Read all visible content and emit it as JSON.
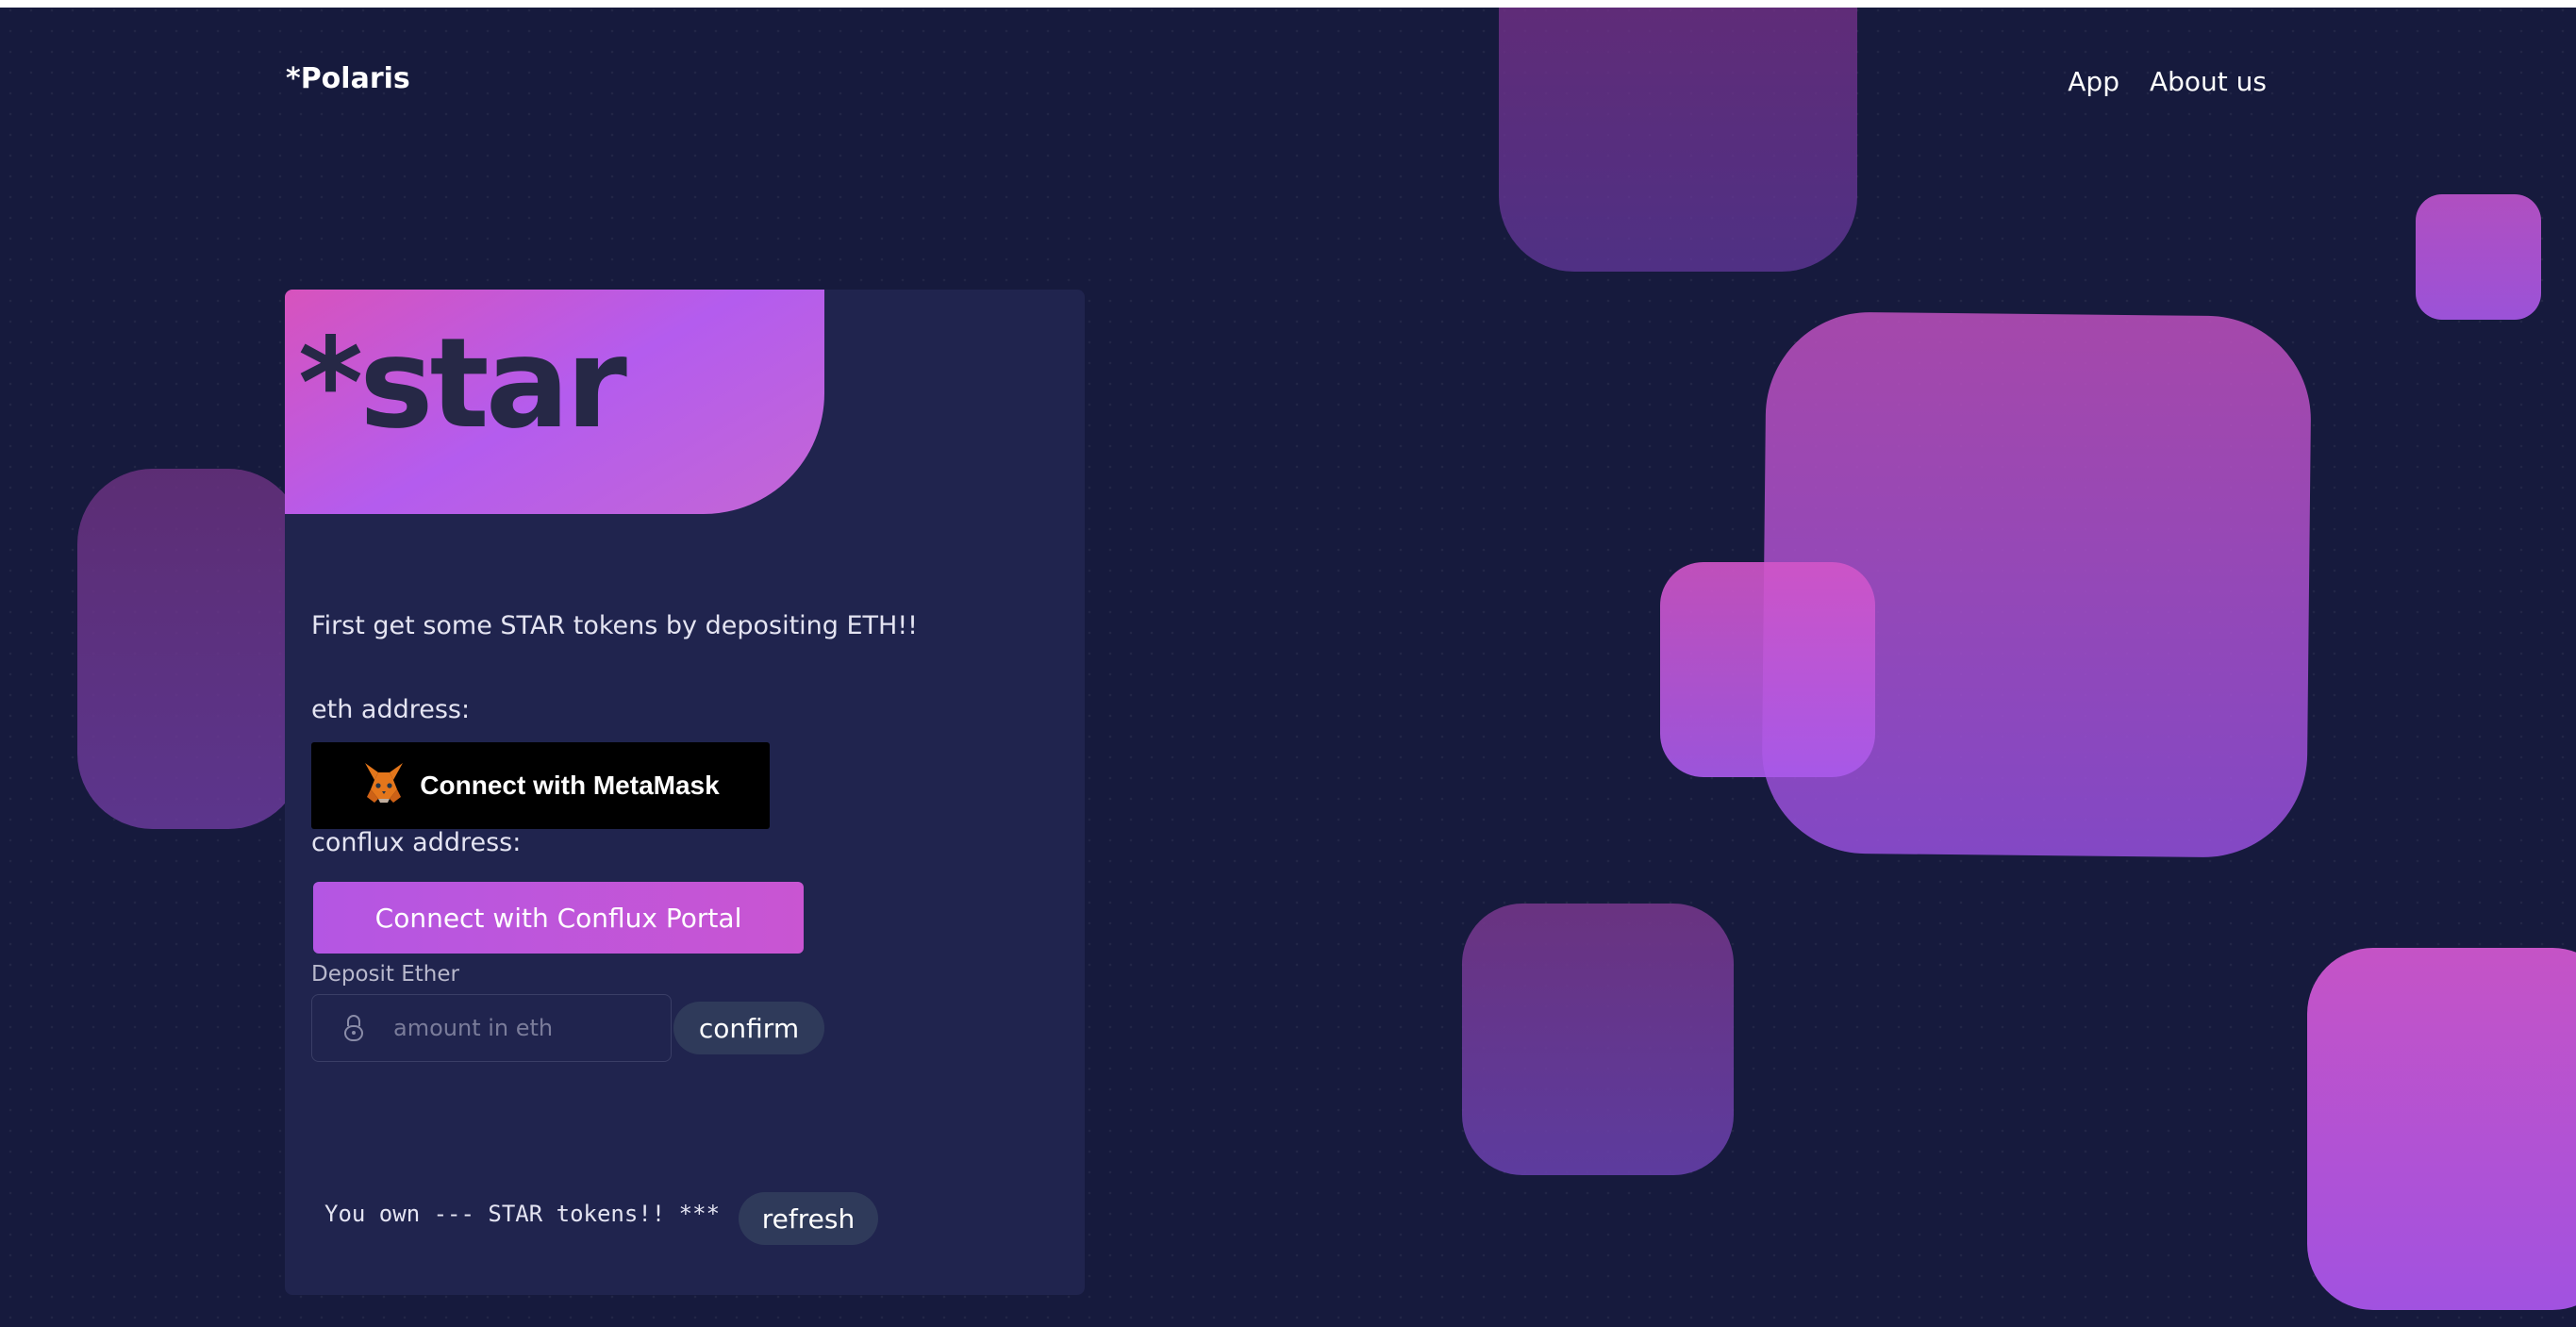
{
  "brand": {
    "logo_text": "*Polaris"
  },
  "nav": {
    "items": [
      {
        "label": "App"
      },
      {
        "label": "About us"
      }
    ]
  },
  "card": {
    "title": "*star",
    "intro_text": "First get some STAR tokens by depositing ETH!!",
    "eth_label": "eth address:",
    "metamask_button_label": "Connect with MetaMask",
    "conflux_label": "conflux address:",
    "conflux_button_label": "Connect with Conflux Portal",
    "deposit_label": "Deposit Ether",
    "amount_placeholder": "amount in eth",
    "confirm_label": "confirm",
    "balance_text": "You own --- STAR tokens!! ***",
    "refresh_label": "refresh"
  },
  "icons": {
    "metamask": "metamask-fox-icon",
    "lock": "lock-icon"
  },
  "colors": {
    "background": "#161a3d",
    "card": "#20244e",
    "accent": "#b45cee",
    "pink": "#d753bd"
  }
}
